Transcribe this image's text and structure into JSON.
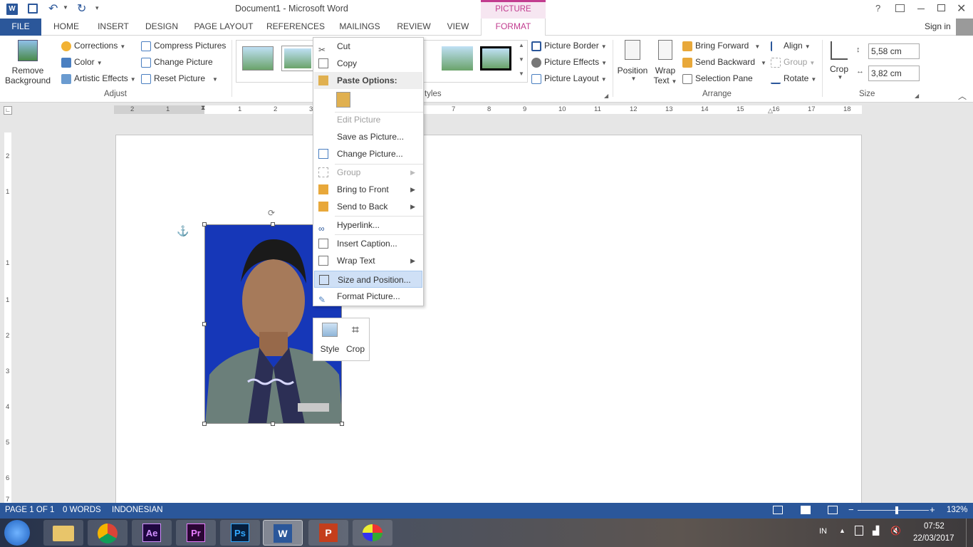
{
  "window": {
    "title": "Document1 - Microsoft Word",
    "picture_tools": "PICTURE TOOLS",
    "help": "?",
    "sign_in": "Sign in"
  },
  "tabs": [
    "FILE",
    "HOME",
    "INSERT",
    "DESIGN",
    "PAGE LAYOUT",
    "REFERENCES",
    "MAILINGS",
    "REVIEW",
    "VIEW",
    "FORMAT"
  ],
  "ribbon": {
    "remove_background": [
      "Remove",
      "Background"
    ],
    "corrections": "Corrections",
    "color": "Color",
    "artistic_effects": "Artistic Effects",
    "compress_pictures": "Compress Pictures",
    "change_picture": "Change Picture",
    "reset_picture": "Reset Picture",
    "adjust_label": "Adjust",
    "styles_label": "Picture Styles",
    "styles_label_visible": "tyles",
    "picture_border": "Picture Border",
    "picture_effects": "Picture Effects",
    "picture_layout": "Picture Layout",
    "position": "Position",
    "wrap_text": [
      "Wrap",
      "Text"
    ],
    "bring_forward": "Bring Forward",
    "send_backward": "Send Backward",
    "selection_pane": "Selection Pane",
    "align": "Align",
    "group": "Group",
    "rotate": "Rotate",
    "arrange_label": "Arrange",
    "crop": "Crop",
    "height": "5,58 cm",
    "width": "3,82 cm",
    "size_label": "Size"
  },
  "ruler": {
    "numbers": [
      "2",
      "1",
      "1",
      "2",
      "3",
      "4",
      "5",
      "6",
      "7",
      "8",
      "9",
      "10",
      "11",
      "12",
      "13",
      "14",
      "15",
      "16",
      "17",
      "18"
    ],
    "v_numbers": [
      "2",
      "1",
      "1",
      "1",
      "2",
      "3",
      "4",
      "5",
      "6",
      "7"
    ]
  },
  "context_menu": {
    "items": [
      {
        "label": "Cut",
        "enabled": true
      },
      {
        "label": "Copy",
        "enabled": true
      },
      {
        "label": "Paste Options:",
        "enabled": true,
        "header": true
      },
      {
        "label": "Edit Picture",
        "enabled": false
      },
      {
        "label": "Save as Picture...",
        "enabled": true
      },
      {
        "label": "Change Picture...",
        "enabled": true
      },
      {
        "label": "Group",
        "enabled": false,
        "submenu": true
      },
      {
        "label": "Bring to Front",
        "enabled": true,
        "submenu": true
      },
      {
        "label": "Send to Back",
        "enabled": true,
        "submenu": true
      },
      {
        "label": "Hyperlink...",
        "enabled": true
      },
      {
        "label": "Insert Caption...",
        "enabled": true
      },
      {
        "label": "Wrap Text",
        "enabled": true,
        "submenu": true
      },
      {
        "label": "Size and Position...",
        "enabled": true,
        "highlighted": true
      },
      {
        "label": "Format Picture...",
        "enabled": true
      }
    ]
  },
  "mini_toolbar": {
    "style": "Style",
    "crop": "Crop"
  },
  "status_bar": {
    "page": "PAGE 1 OF 1",
    "words": "0 WORDS",
    "language": "INDONESIAN",
    "zoom": "132%",
    "zoom_fraction": 0.55
  },
  "taskbar": {
    "lang": "IN",
    "time": "07:52",
    "date": "22/03/2017",
    "apps": [
      "Start",
      "File Explorer",
      "Google Chrome",
      "After Effects",
      "Premiere",
      "Photoshop",
      "Microsoft Word",
      "PowerPoint",
      "Paint"
    ]
  },
  "colors": {
    "word_blue": "#2b579a",
    "format_tab": "#c23c8f",
    "photo_bg": "#1637b8",
    "menu_highlight": "#cfe0f6"
  }
}
